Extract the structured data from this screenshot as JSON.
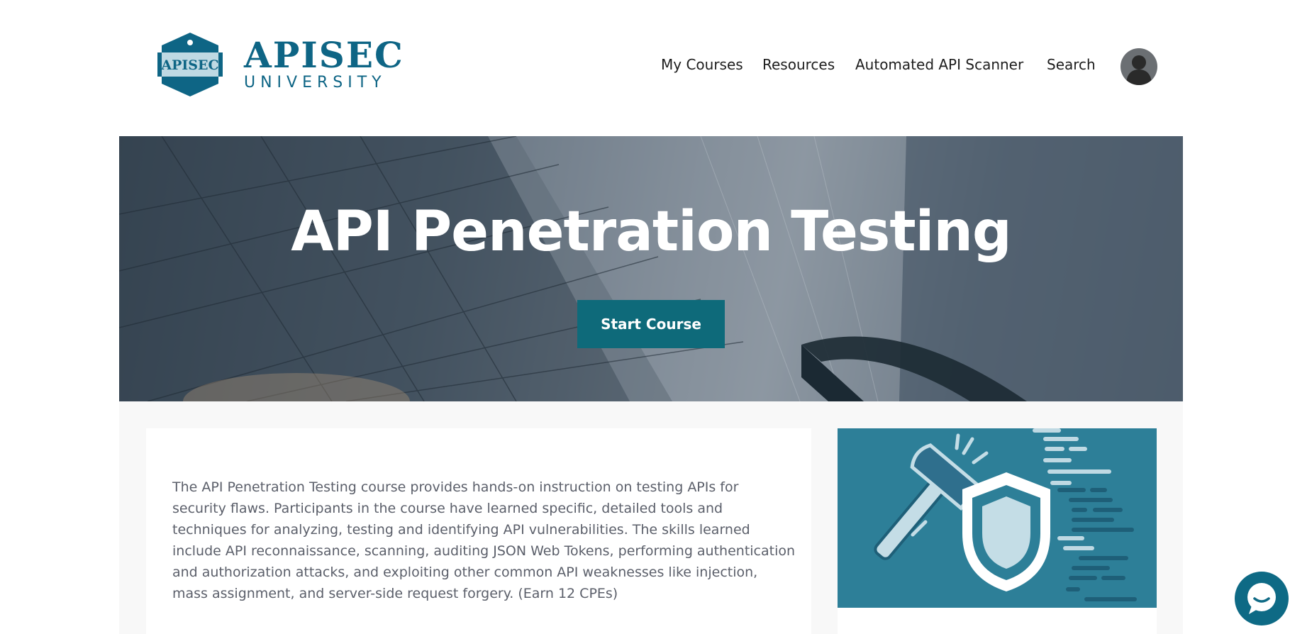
{
  "brand": {
    "badge_text": "APISEC",
    "name": "APISEC",
    "subtitle": "UNIVERSITY",
    "color": "#0e6585"
  },
  "nav": {
    "items": [
      {
        "label": "My Courses"
      },
      {
        "label": "Resources"
      },
      {
        "label": "Automated API Scanner"
      },
      {
        "label": "Search"
      }
    ]
  },
  "hero": {
    "title": "API Penetration Testing",
    "button_label": "Start Course",
    "button_color": "#0e6a7a"
  },
  "course": {
    "description": "The API Penetration Testing course provides hands-on instruction on testing APIs for security flaws. Participants in the course have learned specific, detailed tools and techniques for analyzing, testing and identifying API vulnerabilities. The skills learned include API reconnaissance, scanning, auditing JSON Web Tokens, performing authentication and authorization attacks, and exploiting other common API weaknesses like injection, mass assignment, and server-side request forgery. (Earn 12 CPEs)",
    "image_icons": [
      "hammer-icon",
      "shield-icon",
      "code-lines-icon"
    ],
    "image_color": "#2d7f98"
  },
  "chat": {
    "icon": "chat-bubble-icon"
  }
}
